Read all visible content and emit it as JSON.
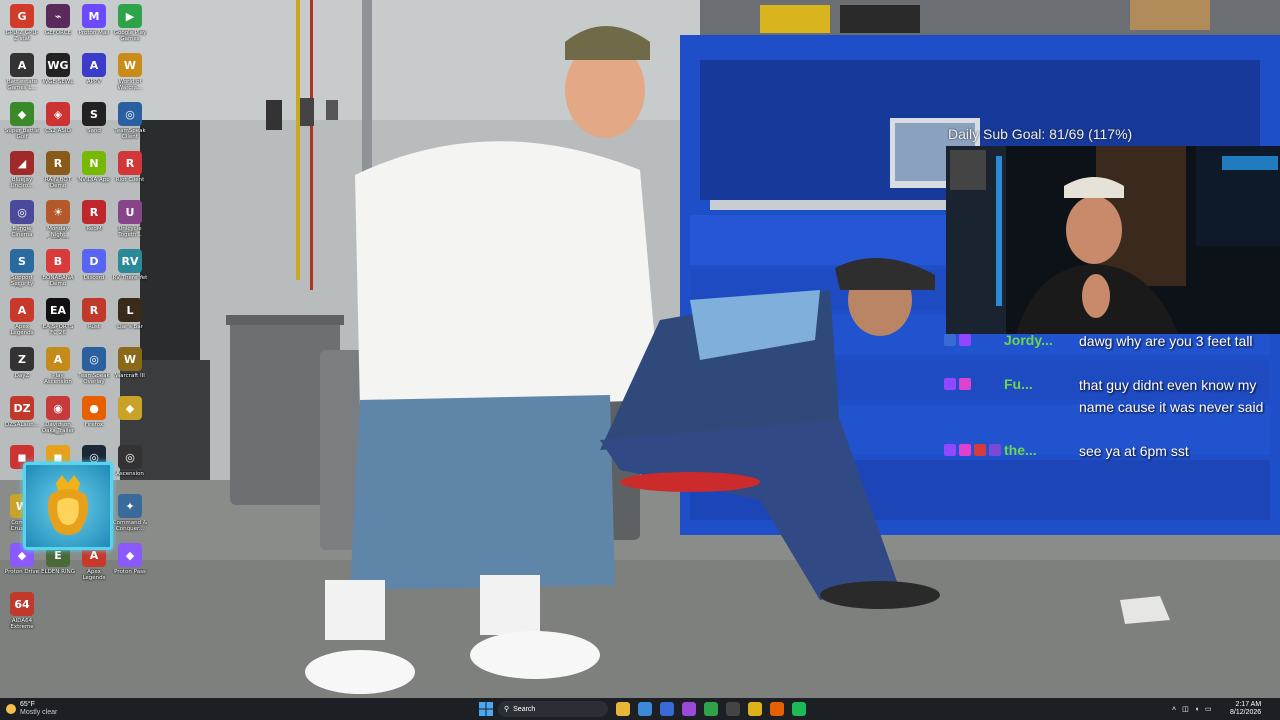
{
  "desktop": {
    "icons": [
      {
        "label": "GPU-Z GPU-Z stat",
        "color": "#d23a2a",
        "glyph": "G"
      },
      {
        "label": "GEFORCE",
        "color": "#5a2a5a",
        "glyph": "⌁"
      },
      {
        "label": "Proton Mail",
        "color": "#6d4aff",
        "glyph": "M"
      },
      {
        "label": "Google Play Games",
        "color": "#2fa34a",
        "glyph": "▶"
      },
      {
        "label": "Battlestate Games L...",
        "color": "#333",
        "glyph": "A"
      },
      {
        "label": "WGE-SEWL",
        "color": "#222",
        "glyph": "WG"
      },
      {
        "label": "APPV",
        "color": "#3b3bcc",
        "glyph": "A"
      },
      {
        "label": "World of Warcra...",
        "color": "#c98b1a",
        "glyph": "W"
      },
      {
        "label": "Super Battle Golf",
        "color": "#3a8a2a",
        "glyph": "◆"
      },
      {
        "label": "CS2 ASIO",
        "color": "#cc3333",
        "glyph": "◈"
      },
      {
        "label": "Sand",
        "color": "#222",
        "glyph": "S"
      },
      {
        "label": "TeamSpeak Client",
        "color": "#2a5fa0",
        "glyph": "◎"
      },
      {
        "label": "Bluejay Unciro...",
        "color": "#a02a2a",
        "glyph": "◢"
      },
      {
        "label": "RAIN BOT Demo",
        "color": "#8a5a1a",
        "glyph": "R"
      },
      {
        "label": "NVIDIA App",
        "color": "#76b900",
        "glyph": "N"
      },
      {
        "label": "Riot Client",
        "color": "#d13639",
        "glyph": "R"
      },
      {
        "label": "Bungie Cinema",
        "color": "#4a4a9a",
        "glyph": "◎"
      },
      {
        "label": "Monday Night Combat Demo",
        "color": "#b45a2a",
        "glyph": "☀"
      },
      {
        "label": "RedM",
        "color": "#c0272d",
        "glyph": "R"
      },
      {
        "label": "Unicycle Togeth...",
        "color": "#884488",
        "glyph": "U"
      },
      {
        "label": "Support Security Su...",
        "color": "#2a6aa0",
        "glyph": "S"
      },
      {
        "label": "BONABANA Demo",
        "color": "#d93a3a",
        "glyph": "B"
      },
      {
        "label": "Discord",
        "color": "#5865f2",
        "glyph": "D"
      },
      {
        "label": "RV There Yet",
        "color": "#2a8a9a",
        "glyph": "RV"
      },
      {
        "label": "Apex Legends",
        "color": "#c8392b",
        "glyph": "A"
      },
      {
        "label": "EA SPORTS FC 26",
        "color": "#111",
        "glyph": "EA"
      },
      {
        "label": "Rust",
        "color": "#c0392b",
        "glyph": "R"
      },
      {
        "label": "Liar's Bar",
        "color": "#3a2a1a",
        "glyph": "L"
      },
      {
        "label": "DayZ",
        "color": "#333",
        "glyph": "Z"
      },
      {
        "label": "Play Ascension",
        "color": "#c48a1a",
        "glyph": "A"
      },
      {
        "label": "TeamSpeak Overlay",
        "color": "#2a5fa0",
        "glyph": "◎"
      },
      {
        "label": "Warcraft III",
        "color": "#8a6a1a",
        "glyph": "W"
      },
      {
        "label": "DZSALaun...",
        "color": "#c0392b",
        "glyph": "DZ"
      },
      {
        "label": "Davidson Oaks Trailer Park",
        "color": "#c63a3a",
        "glyph": "◉"
      },
      {
        "label": "Firefox",
        "color": "#e66000",
        "glyph": "●"
      },
      {
        "label": "",
        "color": "#c9a227",
        "glyph": "◆"
      },
      {
        "label": "",
        "color": "#cc3333",
        "glyph": "◼"
      },
      {
        "label": "Counter-Strike",
        "color": "#e6a21a",
        "glyph": "◼"
      },
      {
        "label": "Steam",
        "color": "#1b2838",
        "glyph": "◎"
      },
      {
        "label": "Ascension",
        "color": "#333",
        "glyph": "◎"
      },
      {
        "label": "Combat Crusade",
        "color": "#c9a227",
        "glyph": "W"
      },
      {
        "label": "Prototype",
        "color": "#2a7a3a",
        "glyph": "◎"
      },
      {
        "label": "The Last of Us",
        "color": "#a02a2a",
        "glyph": "◼"
      },
      {
        "label": "Command & Conquer...",
        "color": "#3a6a9a",
        "glyph": "✦"
      },
      {
        "label": "Proton Drive",
        "color": "#8a5aff",
        "glyph": "◆"
      },
      {
        "label": "ELDEN RING",
        "color": "#4a6a3a",
        "glyph": "E"
      },
      {
        "label": "Apex Legends",
        "color": "#c8392b",
        "glyph": "A"
      },
      {
        "label": "Proton Pass",
        "color": "#8a5aff",
        "glyph": "◆"
      },
      {
        "label": "AIDA64 Extreme",
        "color": "#c0392b",
        "glyph": "64"
      }
    ]
  },
  "overlay": {
    "sub_goal": "Daily Sub Goal: 81/69 (117%)",
    "chat": [
      {
        "name": "Jordy...",
        "name_color": "#6ad64a",
        "message": "dawg why are you 3 feet tall",
        "badges": [
          "#3a6ad6",
          "#9146ff"
        ]
      },
      {
        "name": "Fu...",
        "name_color": "#6ad64a",
        "message": "that guy didnt even know my name cause it was never said",
        "badges": [
          "#9146ff",
          "#e040d0"
        ]
      },
      {
        "name": "the...",
        "name_color": "#6ad64a",
        "message": "see ya at 6pm sst",
        "badges": [
          "#9146ff",
          "#e040d0",
          "#d63a3a",
          "#7a4ad6"
        ]
      }
    ]
  },
  "taskbar": {
    "weather_temp": "65°F",
    "weather_desc": "Mostly clear",
    "search_label": "Search",
    "time": "2:17 AM",
    "date": "8/12/2026",
    "apps": [
      {
        "name": "file-explorer",
        "color": "#e8b43a"
      },
      {
        "name": "copilot",
        "color": "#3a8ad6"
      },
      {
        "name": "app-blue",
        "color": "#3a6ad6"
      },
      {
        "name": "app-purple",
        "color": "#9a4ad6"
      },
      {
        "name": "app-green",
        "color": "#2fa34a"
      },
      {
        "name": "app-dark",
        "color": "#444"
      },
      {
        "name": "chrome",
        "color": "#e0b21a"
      },
      {
        "name": "firefox",
        "color": "#e66000"
      },
      {
        "name": "spotify",
        "color": "#1db954"
      }
    ]
  }
}
